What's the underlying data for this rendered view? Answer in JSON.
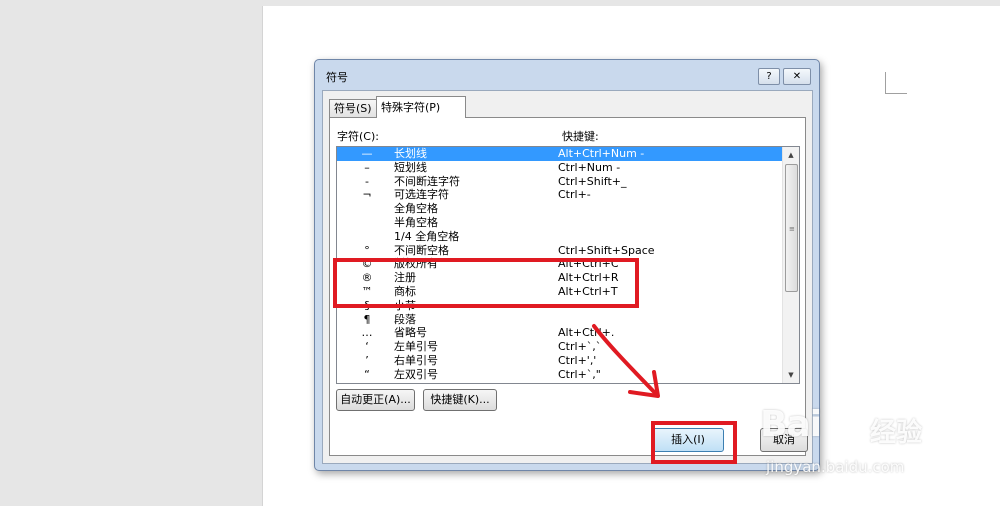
{
  "dialog": {
    "title": "符号",
    "help_label": "?",
    "close_label": "✕",
    "tabs": [
      {
        "label": "符号(S)"
      },
      {
        "label": "特殊字符(P)"
      }
    ],
    "column_char": "字符(C):",
    "column_shortcut": "快捷键:",
    "rows": [
      {
        "glyph": "—",
        "name": "长划线",
        "key": "Alt+Ctrl+Num -"
      },
      {
        "glyph": "–",
        "name": "短划线",
        "key": "Ctrl+Num -"
      },
      {
        "glyph": "-",
        "name": "不间断连字符",
        "key": "Ctrl+Shift+_"
      },
      {
        "glyph": "¬",
        "name": "可选连字符",
        "key": "Ctrl+-"
      },
      {
        "glyph": "",
        "name": "全角空格",
        "key": ""
      },
      {
        "glyph": "",
        "name": "半角空格",
        "key": ""
      },
      {
        "glyph": "",
        "name": "1/4 全角空格",
        "key": ""
      },
      {
        "glyph": "°",
        "name": "不间断空格",
        "key": "Ctrl+Shift+Space"
      },
      {
        "glyph": "©",
        "name": "版权所有",
        "key": "Alt+Ctrl+C"
      },
      {
        "glyph": "®",
        "name": "注册",
        "key": "Alt+Ctrl+R"
      },
      {
        "glyph": "™",
        "name": "商标",
        "key": "Alt+Ctrl+T"
      },
      {
        "glyph": "§",
        "name": "小节",
        "key": ""
      },
      {
        "glyph": "¶",
        "name": "段落",
        "key": ""
      },
      {
        "glyph": "…",
        "name": "省略号",
        "key": "Alt+Ctrl+."
      },
      {
        "glyph": "‘",
        "name": "左单引号",
        "key": "Ctrl+`,`"
      },
      {
        "glyph": "’",
        "name": "右单引号",
        "key": "Ctrl+','"
      },
      {
        "glyph": "“",
        "name": "左双引号",
        "key": "Ctrl+`,\""
      }
    ],
    "autocorrect_label": "自动更正(A)...",
    "shortcut_label": "快捷键(K)...",
    "insert_label": "插入(I)",
    "cancel_label": "取消"
  },
  "watermark": {
    "logo": "Bai",
    "cn": "经验",
    "url": "jingyan.baidu.com"
  },
  "colors": {
    "selection": "#3399ff",
    "annotation": "#e01a22",
    "dialog_frame": "#c9d9ed"
  }
}
